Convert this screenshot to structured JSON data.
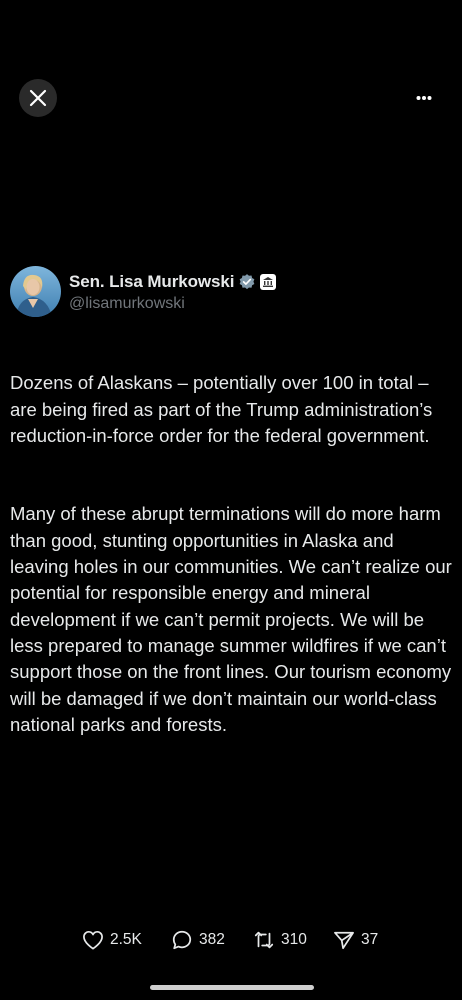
{
  "author": {
    "display_name": "Sen. Lisa Murkowski",
    "handle": "@lisamurkowski"
  },
  "tweet": {
    "paragraphs": [
      "Dozens of Alaskans – potentially over 100 in total – are being fired as part of the Trump administration’s reduction-in-force order for the federal government.",
      "Many of these abrupt terminations will do more harm than good, stunting opportunities in Alaska and leaving holes in our communities. We can’t realize our potential for responsible energy and mineral development if we can’t permit projects. We will be less prepared to manage summer wildfires if we can’t support those on the front lines. Our tourism economy will be damaged if we don’t maintain our world-class national parks and forests."
    ]
  },
  "actions": {
    "likes": "2.5K",
    "replies": "382",
    "reposts": "310",
    "views": "37"
  },
  "icons": {
    "close": "close-icon",
    "more": "more-icon",
    "verified": "verified-badge-icon",
    "government": "government-badge-icon",
    "like": "heart-icon",
    "reply": "reply-icon",
    "repost": "repost-icon",
    "views": "views-icon"
  },
  "colors": {
    "background": "#000000",
    "text": "#e7e9ea",
    "secondary_text": "#71767b",
    "verified": "#829aab"
  }
}
